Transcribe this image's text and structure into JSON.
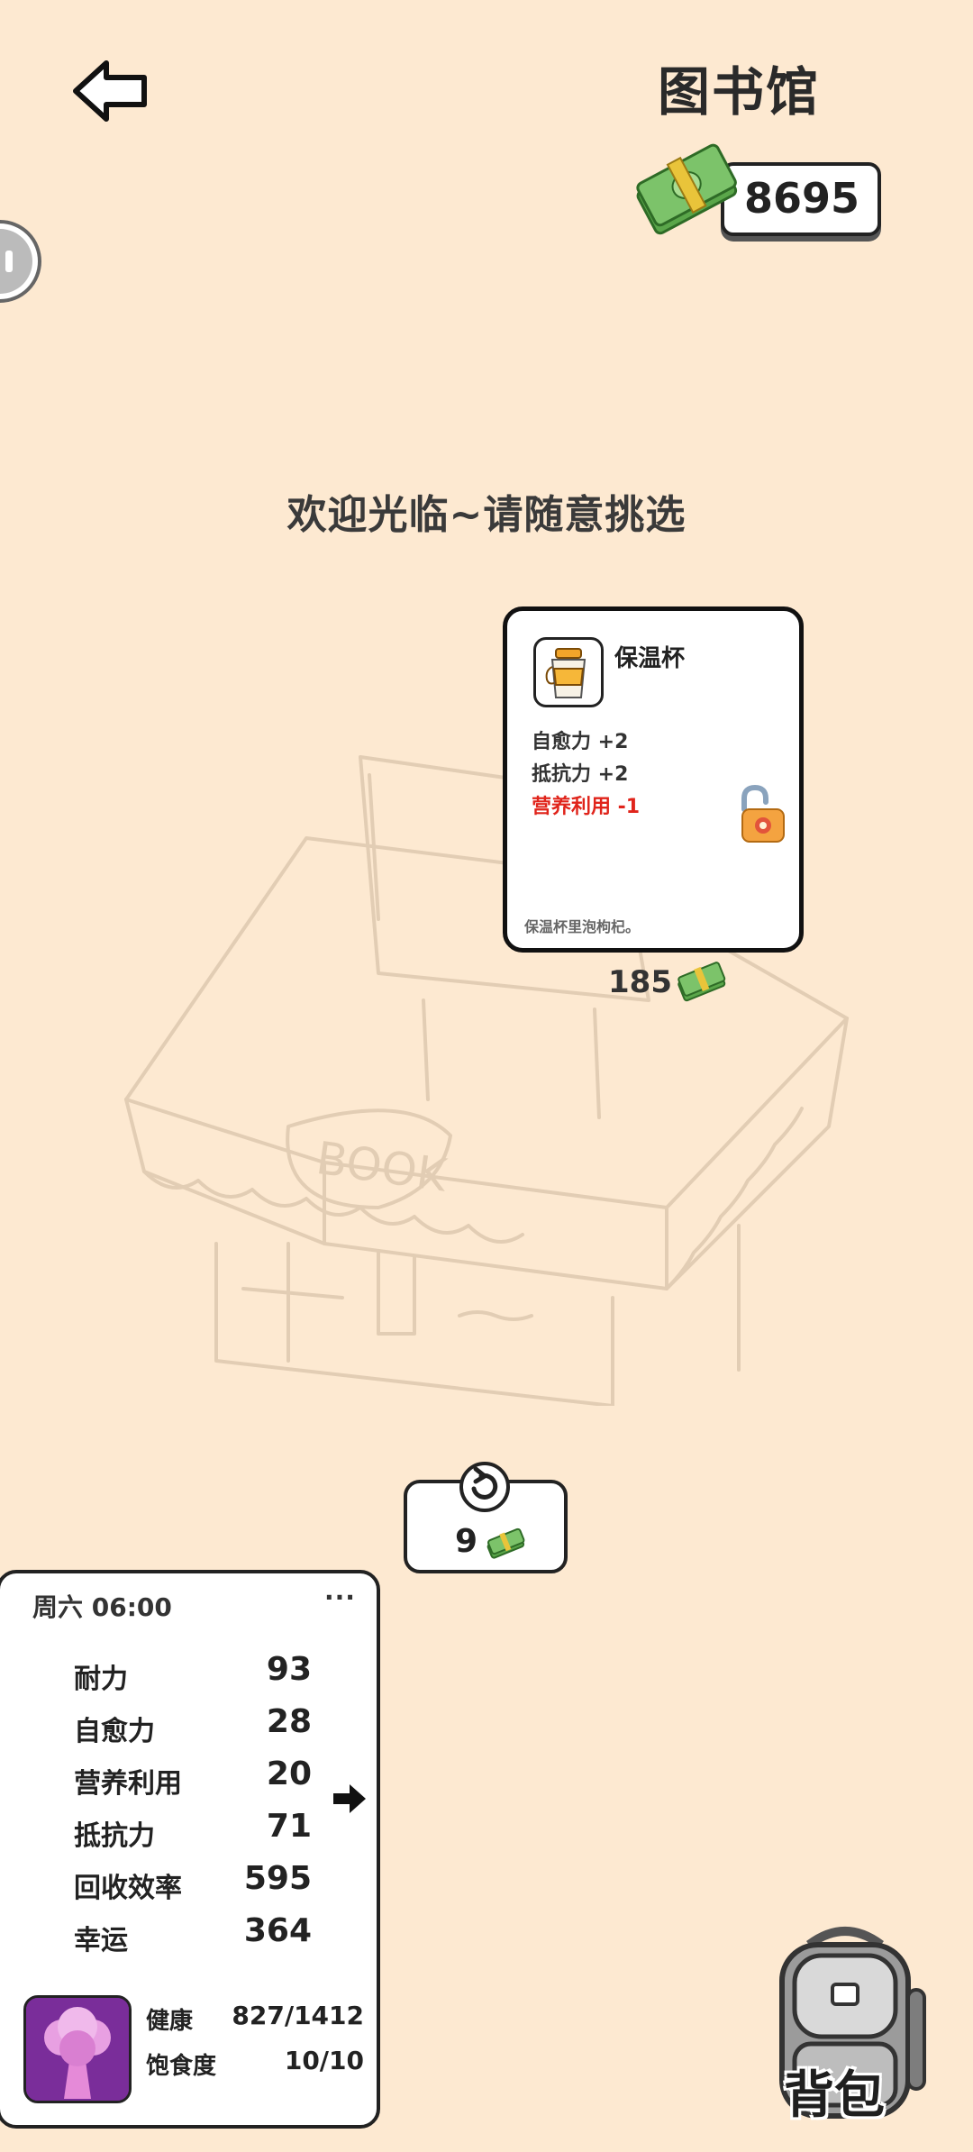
{
  "header": {
    "title": "图书馆",
    "money": "8695"
  },
  "shop": {
    "welcome_text": "欢迎光临~请随意挑选"
  },
  "item": {
    "name": "保温杯",
    "stats": [
      "自愈力 +2",
      "抵抗力 +2"
    ],
    "negative_stat": "营养利用 -1",
    "description": "保温杯里泡枸杞。",
    "price": "185",
    "lock_state": "unlocked"
  },
  "refresh": {
    "cost": "9"
  },
  "status_panel": {
    "time": "周六 06:00",
    "menu": "···",
    "stats": [
      {
        "name": "耐力",
        "value": "93"
      },
      {
        "name": "自愈力",
        "value": "28"
      },
      {
        "name": "营养利用",
        "value": "20"
      },
      {
        "name": "抵抗力",
        "value": "71"
      },
      {
        "name": "回收效率",
        "value": "595"
      },
      {
        "name": "幸运",
        "value": "364"
      }
    ],
    "health_label": "健康",
    "health_value": "827/1412",
    "satiety_label": "饱食度",
    "satiety_value": "10/10"
  },
  "backpack": {
    "label": "背包"
  },
  "colors": {
    "background": "#fde9d1",
    "negative": "#e0241b",
    "avatar": "#7a2d9a",
    "cash_green": "#7cc36a"
  }
}
